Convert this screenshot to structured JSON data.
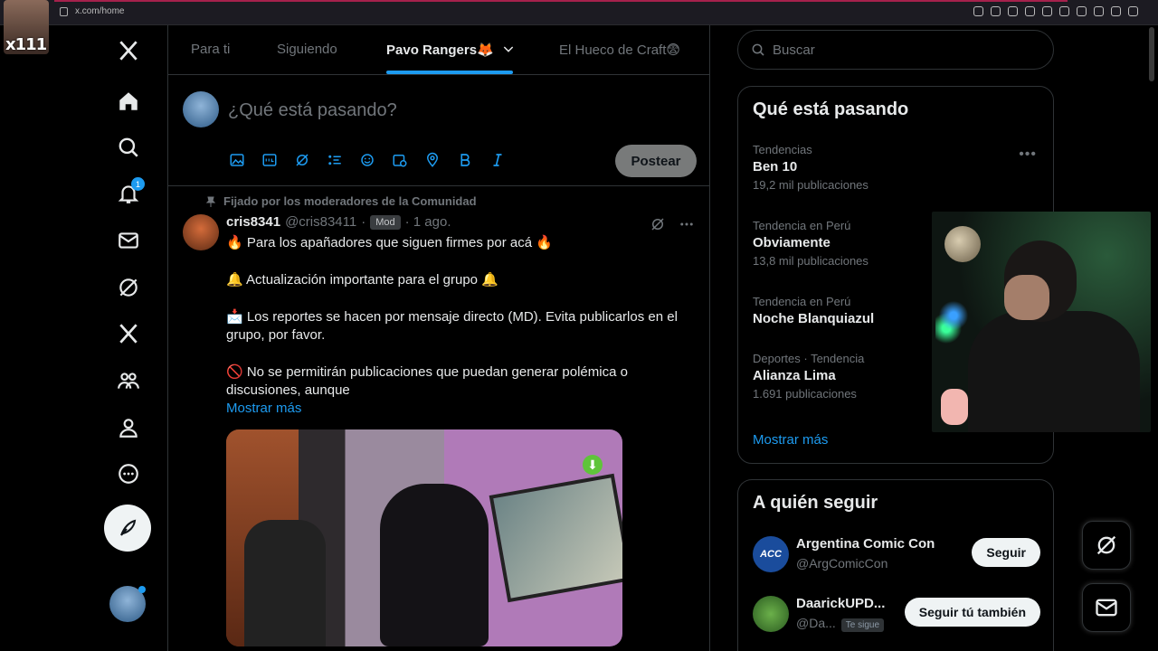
{
  "browser": {
    "url": "x.com/home"
  },
  "overlay": {
    "tag": "x111"
  },
  "nav": {
    "notifications_badge": "1"
  },
  "tabs": [
    {
      "label": "Para ti"
    },
    {
      "label": "Siguiendo"
    },
    {
      "label": "Pavo Rangers🦊"
    },
    {
      "label": "El Hueco de Craft😨"
    }
  ],
  "composer": {
    "placeholder": "¿Qué está pasando?",
    "post_label": "Postear"
  },
  "post": {
    "pinned": "Fijado por los moderadores de la Comunidad",
    "name": "cris8341",
    "handle": "@cris83411",
    "mod": "Mod",
    "time": "· 1 ago.",
    "lines": [
      "🔥 Para los apañadores que siguen firmes por acá 🔥",
      "🔔 Actualización importante para el grupo 🔔",
      "📩 Los reportes se hacen por mensaje directo (MD). Evita publicarlos en el grupo, por favor.",
      "🚫 No se permitirán publicaciones que puedan generar polémica o discusiones, aunque"
    ],
    "show_more": "Mostrar más"
  },
  "search": {
    "placeholder": "Buscar"
  },
  "trends": {
    "title": "Qué está pasando",
    "items": [
      {
        "context": "Tendencias",
        "topic": "Ben 10",
        "count": "19,2 mil publicaciones"
      },
      {
        "context": "Tendencia en Perú",
        "topic": "Obviamente",
        "count": "13,8 mil publicaciones"
      },
      {
        "context": "Tendencia en Perú",
        "topic": "Noche Blanquiazul",
        "count": ""
      },
      {
        "context": "Deportes · Tendencia",
        "topic": "Alianza Lima",
        "count": "1.691 publicaciones"
      }
    ],
    "more": "Mostrar más"
  },
  "who_to_follow": {
    "title": "A quién seguir",
    "items": [
      {
        "name": "Argentina Comic Con",
        "handle": "@ArgComicCon",
        "button": "Seguir",
        "avatar_text": "ACC"
      },
      {
        "name": "DaarickUPD...",
        "handle": "@Da...",
        "follows_you": "Te sigue",
        "button": "Seguir tú también"
      }
    ]
  },
  "colors": {
    "accent": "#1d9bf0",
    "background": "#000000",
    "border": "#2f3336",
    "muted": "#71767b"
  }
}
